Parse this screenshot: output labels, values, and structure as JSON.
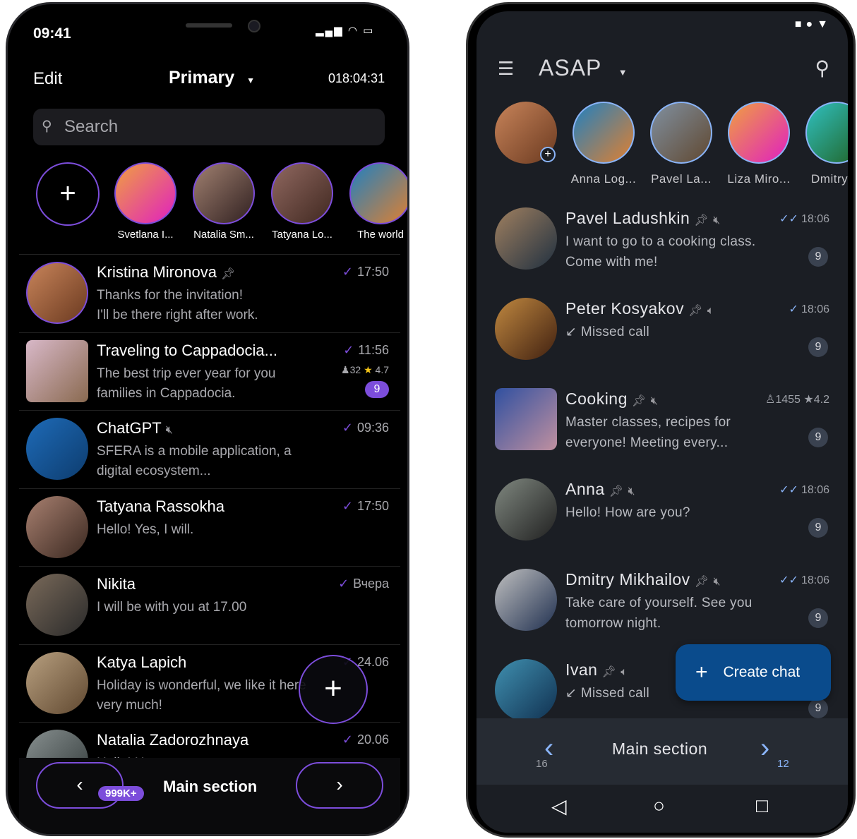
{
  "left": {
    "status": {
      "time": "09:41"
    },
    "header": {
      "edit": "Edit",
      "title": "Primary",
      "timer": "018:04:31"
    },
    "search": {
      "placeholder": "Search"
    },
    "stories": [
      {
        "label": "Svetlana I..."
      },
      {
        "label": "Natalia Sm..."
      },
      {
        "label": "Tatyana Lo..."
      },
      {
        "label": "The world"
      }
    ],
    "chats": [
      {
        "name": "Kristina Mironova",
        "pinned": true,
        "message": "Thanks for the invitation!\nI'll be there right after work.",
        "time": "17:50"
      },
      {
        "name": "Traveling to Cappadocia...",
        "message": "The best trip ever year for you families in Cappadocia.",
        "time": "11:56",
        "members": "32",
        "rating": "4.7",
        "unread": "9"
      },
      {
        "name": "ChatGPT",
        "muted": true,
        "message": "SFERA is a mobile application, a digital ecosystem...",
        "time": "09:36"
      },
      {
        "name": "Tatyana Rassokha",
        "message": "Hello! Yes, I will.",
        "time": "17:50"
      },
      {
        "name": "Nikita",
        "message": "I will be with you at 17.00",
        "time": "Вчера"
      },
      {
        "name": "Katya Lapich",
        "message": "Holiday is wonderful, we like it here very much!",
        "time": "24.06"
      },
      {
        "name": "Natalia Zadorozhnaya",
        "message": "Hello! H...",
        "time": "20.06"
      }
    ],
    "bottom": {
      "badge": "999K+",
      "label": "Main section"
    },
    "accent": "#7c4ddb"
  },
  "right": {
    "header": {
      "title": "ASAP"
    },
    "stories": [
      {
        "label": "Anna Log..."
      },
      {
        "label": "Pavel La..."
      },
      {
        "label": "Liza Miro..."
      },
      {
        "label": "Dmitry M"
      }
    ],
    "chats": [
      {
        "name": "Pavel Ladushkin",
        "icons": "pin,muted",
        "message": "I want to go to a cooking class. Come with me!",
        "time": "18:06",
        "read": "double",
        "unread": "9"
      },
      {
        "name": "Peter Kosyakov",
        "icons": "pin,sound",
        "message": "Missed call",
        "missed": true,
        "time": "18:06",
        "read": "single",
        "unread": "9"
      },
      {
        "name": "Cooking",
        "icons": "pin,muted",
        "message": "Master classes, recipes for everyone! Meeting every...",
        "members": "1455",
        "rating": "4.2",
        "unread": "9"
      },
      {
        "name": "Anna",
        "icons": "pin,muted",
        "message": "Hello! How are you?",
        "time": "18:06",
        "read": "double",
        "unread": "9"
      },
      {
        "name": "Dmitry Mikhailov",
        "icons": "pin,muted",
        "message": "Take care of yourself. See you tomorrow night.",
        "time": "18:06",
        "read": "double",
        "unread": "9"
      },
      {
        "name": "Ivan",
        "icons": "pin,sound",
        "message": "Missed call",
        "missed": true,
        "unread": "9"
      }
    ],
    "fab": {
      "label": "Create chat"
    },
    "bottom": {
      "label": "Main section",
      "prev_count": "16",
      "next_count": "12"
    },
    "accent": "#0a4b8c"
  }
}
